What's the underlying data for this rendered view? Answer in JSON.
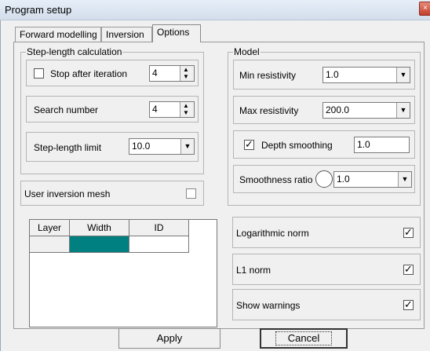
{
  "window": {
    "title": "Program setup",
    "close_glyph": "×"
  },
  "tabs": [
    {
      "label": "Forward modelling",
      "active": false
    },
    {
      "label": "Inversion",
      "active": false
    },
    {
      "label": "Options",
      "active": true
    }
  ],
  "step_length": {
    "title": "Step-length calculation",
    "stop_after_iteration": {
      "label": "Stop after iteration",
      "checked": false,
      "value": "4"
    },
    "search_number": {
      "label": "Search number",
      "value": "4"
    },
    "step_length_limit": {
      "label": "Step-length limit",
      "value": "10.0"
    }
  },
  "user_mesh": {
    "label": "User inversion mesh",
    "checked": false
  },
  "mesh_table": {
    "columns": [
      "Layer",
      "Width",
      "ID"
    ],
    "selected_color": "#008080"
  },
  "model": {
    "title": "Model",
    "min_resistivity": {
      "label": "Min resistivity",
      "value": "1.0"
    },
    "max_resistivity": {
      "label": "Max resistivity",
      "value": "200.0"
    },
    "depth_smoothing": {
      "label": "Depth smoothing",
      "checked": true,
      "value": "1.0"
    },
    "smoothness_ratio": {
      "label": "Smoothness ratio",
      "value": "1.0"
    }
  },
  "options": {
    "log_norm": {
      "label": "Logarithmic norm",
      "checked": true
    },
    "l1_norm": {
      "label": "L1 norm",
      "checked": true
    },
    "show_warnings": {
      "label": "Show warnings",
      "checked": true
    }
  },
  "buttons": {
    "apply": "Apply",
    "cancel": "Cancel"
  },
  "glyphs": {
    "check": "✓",
    "up": "▲",
    "down": "▼"
  }
}
